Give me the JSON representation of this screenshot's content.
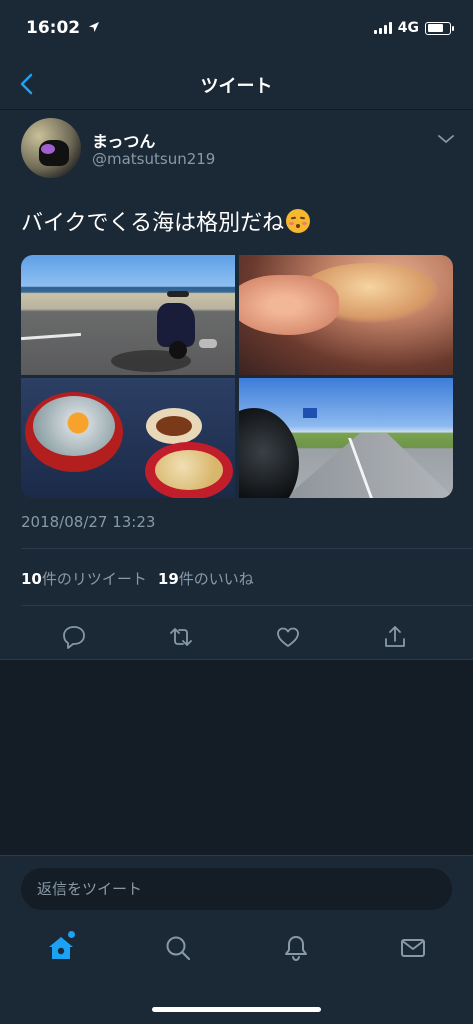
{
  "status_bar": {
    "time": "16:02",
    "network": "4G",
    "battery_level": 0.75
  },
  "nav": {
    "title": "ツイート"
  },
  "tweet": {
    "user_name": "まっつん",
    "user_handle": "@matsutsun219",
    "text": "バイクでくる海は格別だね",
    "timestamp": "2018/08/27 13:23",
    "retweet_count": "10",
    "retweet_label": "件のリツイート",
    "like_count": "19",
    "like_label": "件のいいね"
  },
  "reply": {
    "placeholder": "返信をツイート"
  },
  "colors": {
    "background": "#141d26",
    "panel": "#1b2836",
    "secondary_text": "#8899a6",
    "accent": "#1da1f2"
  },
  "icons": [
    "back-chevron-icon",
    "chevron-down-icon",
    "reply-icon",
    "retweet-icon",
    "like-icon",
    "share-icon",
    "home-icon",
    "search-icon",
    "notifications-icon",
    "messages-icon"
  ]
}
